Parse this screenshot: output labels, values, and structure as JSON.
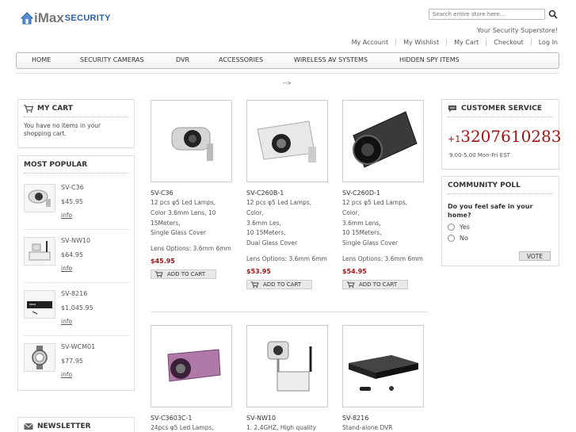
{
  "header": {
    "logo_main": "iMax",
    "logo_sub": "SECURITY",
    "search_placeholder": "Search entire store here...",
    "tagline": "Your Security Superstore!",
    "links": [
      "My Account",
      "My Wishlist",
      "My Cart",
      "Checkout",
      "Log In"
    ]
  },
  "nav": [
    "HOME",
    "SECURITY CAMERAS",
    "DVR",
    "ACCESSORIES",
    "WIRELESS AV SYSTEMS",
    "HIDDEN SPY ITEMS"
  ],
  "arrow_text": "-->",
  "cart": {
    "title": "MY CART",
    "text": "You have no items in your shopping cart."
  },
  "most_popular": {
    "title": "MOST POPULAR",
    "items": [
      {
        "name": "SV-C36",
        "price": "$45.95",
        "info": "info"
      },
      {
        "name": "SV-NW10",
        "price": "$64.95",
        "info": "info"
      },
      {
        "name": "SV-8216",
        "price": "$1,045.95",
        "info": "info"
      },
      {
        "name": "SV-WCM01",
        "price": "$77.95",
        "info": "info"
      }
    ]
  },
  "newsletter": {
    "title": "NEWSLETTER"
  },
  "products": [
    {
      "name": "SV-C36",
      "desc": "12 pcs φ5 Led Lamps,\nColor 3.6mm Lens, 10\n 15Meters,\nSingle Glass Cover",
      "lens": "Lens Options: 3.6mm 6mm",
      "price": "$45.95",
      "add": "ADD TO CART"
    },
    {
      "name": "SV-C260B-1",
      "desc": "12 pcs φ5 Led Lamps,\nColor,\n3.6mm Les,\n10 15Meters,\nDual Glass Cover",
      "lens": "Lens Options: 3.6mm 6mm",
      "price": "$53.95",
      "add": "ADD TO CART"
    },
    {
      "name": "SV-C260D-1",
      "desc": "12 pcs φ5 Led Lamps,\nColor,\n3.6mm Lens,\n10 15Meters,\nSingle Glass Cover",
      "lens": "Lens Options: 3.6mm 6mm",
      "price": "$54.95",
      "add": "ADD TO CART"
    },
    {
      "name": "SV-C3603C-1",
      "desc": "24pcs φ5 Led Lamps,"
    },
    {
      "name": "SV-NW10",
      "desc": "1. 2.4GHZ, High quality"
    },
    {
      "name": "SV-8216",
      "desc": "Stand-alone DVR"
    }
  ],
  "customer_service": {
    "title": "CUSTOMER SERVICE",
    "phone_prefix": "+1",
    "phone": "3207610283",
    "hours": "9.00-5.00 Mon-Fri EST"
  },
  "poll": {
    "title": "COMMUNITY POLL",
    "question": "Do you feel safe in your home?",
    "options": [
      "Yes",
      "No"
    ],
    "vote": "VOTE"
  },
  "colors": {
    "brand_blue": "#2a5fa8",
    "price_red": "#a01515"
  }
}
